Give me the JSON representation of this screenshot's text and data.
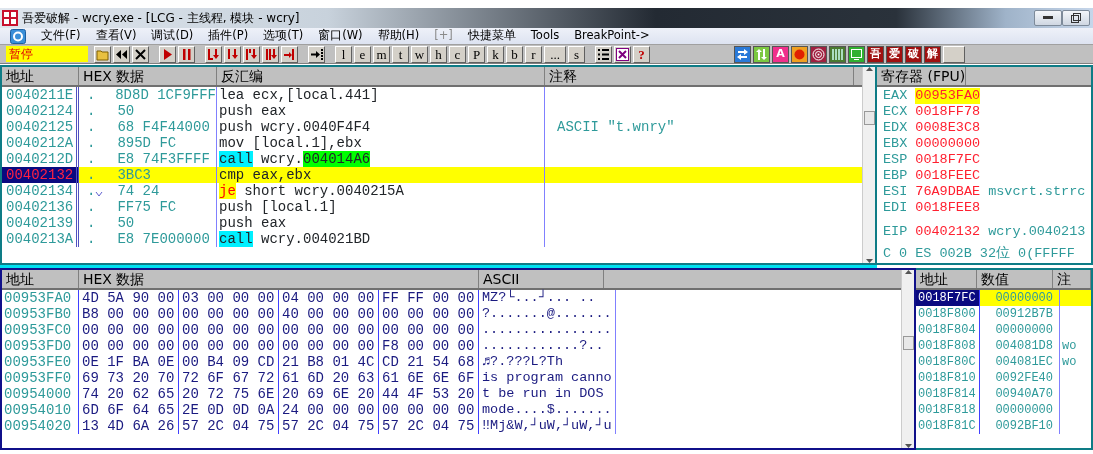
{
  "window": {
    "title": "吾爱破解 - wcry.exe - [LCG - 主线程, 模块 - wcry]"
  },
  "menu": [
    {
      "label": "文件(F)",
      "disabled": false
    },
    {
      "label": "查看(V)",
      "disabled": false
    },
    {
      "label": "调试(D)",
      "disabled": false
    },
    {
      "label": "插件(P)",
      "disabled": false
    },
    {
      "label": "选项(T)",
      "disabled": false
    },
    {
      "label": "窗口(W)",
      "disabled": false
    },
    {
      "label": "帮助(H)",
      "disabled": false
    },
    {
      "label": "[+]",
      "disabled": true
    },
    {
      "label": "快捷菜单",
      "disabled": false
    },
    {
      "label": "Tools",
      "disabled": false
    },
    {
      "label": "BreakPoint->",
      "disabled": false
    }
  ],
  "toolbar": {
    "status": "暂停",
    "letter_buttons": [
      "l",
      "e",
      "m",
      "t",
      "w",
      "h",
      "c",
      "P",
      "k",
      "b",
      "r",
      "...",
      "s"
    ],
    "help_label": "?",
    "plugin_letter": "A",
    "brand_buttons": [
      "吾",
      "爱",
      "破",
      "解"
    ]
  },
  "disassembly": {
    "columns": [
      "地址",
      "HEX 数据",
      "反汇编",
      "注释"
    ],
    "rows": [
      {
        "address": "0040211E",
        "marker": ".",
        "jump": false,
        "hex": "8D8D 1CF9FFF",
        "mnemonic": {
          "text": "lea",
          "kind": "plain"
        },
        "operands": [
          {
            "text": "ecx,[local.441]",
            "kind": "plain"
          }
        ],
        "selected": false
      },
      {
        "address": "00402124",
        "marker": ".",
        "jump": false,
        "hex": "50",
        "mnemonic": {
          "text": "push",
          "kind": "plain"
        },
        "operands": [
          {
            "text": "eax",
            "kind": "plain"
          }
        ],
        "selected": false
      },
      {
        "address": "00402125",
        "marker": ".",
        "jump": false,
        "hex": "68 F4F44000",
        "mnemonic": {
          "text": "push",
          "kind": "plain"
        },
        "operands": [
          {
            "text": "wcry.0040F4F4",
            "kind": "plain"
          }
        ],
        "comment": "ASCII \"t.wnry\"",
        "selected": false
      },
      {
        "address": "0040212A",
        "marker": ".",
        "jump": false,
        "hex": "895D FC",
        "mnemonic": {
          "text": "mov",
          "kind": "plain"
        },
        "operands": [
          {
            "text": "[local.1],ebx",
            "kind": "plain"
          }
        ],
        "selected": false
      },
      {
        "address": "0040212D",
        "marker": ".",
        "jump": false,
        "hex": "E8 74F3FFFF",
        "mnemonic": {
          "text": "call",
          "kind": "call"
        },
        "operands": [
          {
            "text": "wcry.",
            "kind": "plain"
          },
          {
            "text": "004014A6",
            "kind": "target"
          }
        ],
        "selected": false
      },
      {
        "address": "00402132",
        "marker": ".",
        "jump": false,
        "hex": "3BC3",
        "mnemonic": {
          "text": "cmp",
          "kind": "plain"
        },
        "operands": [
          {
            "text": "eax,ebx",
            "kind": "plain"
          }
        ],
        "selected": true
      },
      {
        "address": "00402134",
        "marker": ".",
        "jump": true,
        "hex": "74 24",
        "mnemonic": {
          "text": "je",
          "kind": "jump"
        },
        "operands": [
          {
            "text": "short wcry.0040215A",
            "kind": "plain"
          }
        ],
        "selected": false
      },
      {
        "address": "00402136",
        "marker": ".",
        "jump": false,
        "hex": "FF75 FC",
        "mnemonic": {
          "text": "push",
          "kind": "plain"
        },
        "operands": [
          {
            "text": "[local.1]",
            "kind": "plain"
          }
        ],
        "selected": false
      },
      {
        "address": "00402139",
        "marker": ".",
        "jump": false,
        "hex": "50",
        "mnemonic": {
          "text": "push",
          "kind": "plain"
        },
        "operands": [
          {
            "text": "eax",
            "kind": "plain"
          }
        ],
        "selected": false
      },
      {
        "address": "0040213A",
        "marker": ".",
        "jump": false,
        "hex": "E8 7E000000",
        "mnemonic": {
          "text": "call",
          "kind": "call"
        },
        "operands": [
          {
            "text": "wcry.004021BD",
            "kind": "plain"
          }
        ],
        "selected": false
      }
    ]
  },
  "registers": {
    "title": "寄存器 (FPU)",
    "groups": [
      [
        {
          "name": "EAX",
          "value": "00953FA0",
          "changed": true
        },
        {
          "name": "ECX",
          "value": "0018FF78",
          "changed": false
        },
        {
          "name": "EDX",
          "value": "0008E3C8",
          "changed": false
        },
        {
          "name": "EBX",
          "value": "00000000",
          "changed": false
        },
        {
          "name": "ESP",
          "value": "0018F7FC",
          "changed": false
        },
        {
          "name": "EBP",
          "value": "0018FEEC",
          "changed": false
        },
        {
          "name": "ESI",
          "value": "76A9DBAE",
          "comment": "msvcrt.strrc",
          "changed": false
        },
        {
          "name": "EDI",
          "value": "0018FEE8",
          "changed": false
        }
      ],
      [
        {
          "name": "EIP",
          "value": "00402132",
          "comment": "wcry.0040213",
          "changed": false
        }
      ]
    ],
    "flag_line": [
      "C",
      "0",
      "ES",
      "002B",
      "32位",
      "0(FFFFF"
    ]
  },
  "dump": {
    "columns": [
      "地址",
      "HEX 数据",
      "ASCII"
    ],
    "rows": [
      {
        "address": "00953FA0",
        "hex_groups": [
          "4D 5A 90 00",
          "03 00 00 00",
          "04 00 00 00",
          "FF FF 00 00"
        ],
        "ascii": "MZ?└...┘...   .."
      },
      {
        "address": "00953FB0",
        "hex_groups": [
          "B8 00 00 00",
          "00 00 00 00",
          "40 00 00 00",
          "00 00 00 00"
        ],
        "ascii": "?.......@......."
      },
      {
        "address": "00953FC0",
        "hex_groups": [
          "00 00 00 00",
          "00 00 00 00",
          "00 00 00 00",
          "00 00 00 00"
        ],
        "ascii": "................"
      },
      {
        "address": "00953FD0",
        "hex_groups": [
          "00 00 00 00",
          "00 00 00 00",
          "00 00 00 00",
          "F8 00 00 00"
        ],
        "ascii": "............?.."
      },
      {
        "address": "00953FE0",
        "hex_groups": [
          "0E 1F BA 0E",
          "00 B4 09 CD",
          "21 B8 01 4C",
          "CD 21 54 68"
        ],
        "ascii": "♬?.???L?Th"
      },
      {
        "address": "00953FF0",
        "hex_groups": [
          "69 73 20 70",
          "72 6F 67 72",
          "61 6D 20 63",
          "61 6E 6E 6F"
        ],
        "ascii": "is program canno"
      },
      {
        "address": "00954000",
        "hex_groups": [
          "74 20 62 65",
          "20 72 75 6E",
          "20 69 6E 20",
          "44 4F 53 20"
        ],
        "ascii": "t be run in DOS "
      },
      {
        "address": "00954010",
        "hex_groups": [
          "6D 6F 64 65",
          "2E 0D 0D 0A",
          "24 00 00 00",
          "00 00 00 00"
        ],
        "ascii": "mode....$......."
      },
      {
        "address": "00954020",
        "hex_groups": [
          "13 4D 6A 26",
          "57 2C 04 75",
          "57 2C 04 75",
          "57 2C 04 75"
        ],
        "ascii": "‼Mj&W,┘uW,┘uW,┘u"
      }
    ]
  },
  "stack": {
    "columns": [
      "地址",
      "数值",
      "注"
    ],
    "rows": [
      {
        "address": "0018F7FC",
        "value": "00000000",
        "selected": true
      },
      {
        "address": "0018F800",
        "value": "00912B7B",
        "selected": false
      },
      {
        "address": "0018F804",
        "value": "00000000",
        "selected": false
      },
      {
        "address": "0018F808",
        "value": "004081D8",
        "comment": "wo",
        "selected": false
      },
      {
        "address": "0018F80C",
        "value": "004081EC",
        "comment": "wo",
        "selected": false
      },
      {
        "address": "0018F810",
        "value": "0092FE40",
        "selected": false
      },
      {
        "address": "0018F814",
        "value": "00940A70",
        "selected": false
      },
      {
        "address": "0018F818",
        "value": "00000000",
        "selected": false
      },
      {
        "address": "0018F81C",
        "value": "0092BF10",
        "selected": false
      }
    ]
  }
}
